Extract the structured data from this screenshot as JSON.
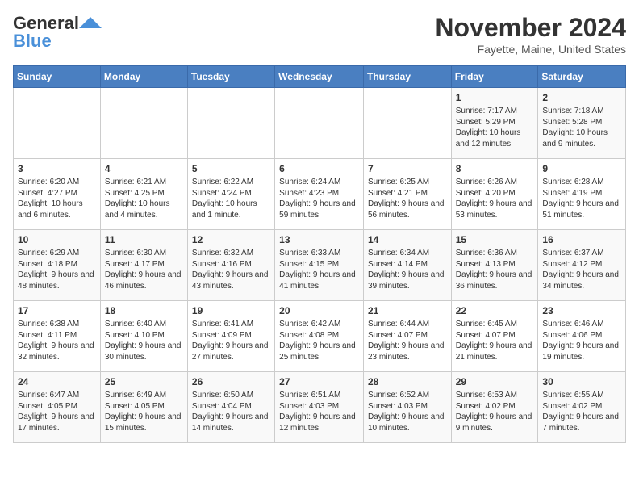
{
  "header": {
    "logo_general": "General",
    "logo_blue": "Blue",
    "month": "November 2024",
    "location": "Fayette, Maine, United States"
  },
  "weekdays": [
    "Sunday",
    "Monday",
    "Tuesday",
    "Wednesday",
    "Thursday",
    "Friday",
    "Saturday"
  ],
  "weeks": [
    [
      {
        "day": "",
        "info": ""
      },
      {
        "day": "",
        "info": ""
      },
      {
        "day": "",
        "info": ""
      },
      {
        "day": "",
        "info": ""
      },
      {
        "day": "",
        "info": ""
      },
      {
        "day": "1",
        "info": "Sunrise: 7:17 AM\nSunset: 5:29 PM\nDaylight: 10 hours and 12 minutes."
      },
      {
        "day": "2",
        "info": "Sunrise: 7:18 AM\nSunset: 5:28 PM\nDaylight: 10 hours and 9 minutes."
      }
    ],
    [
      {
        "day": "3",
        "info": "Sunrise: 6:20 AM\nSunset: 4:27 PM\nDaylight: 10 hours and 6 minutes."
      },
      {
        "day": "4",
        "info": "Sunrise: 6:21 AM\nSunset: 4:25 PM\nDaylight: 10 hours and 4 minutes."
      },
      {
        "day": "5",
        "info": "Sunrise: 6:22 AM\nSunset: 4:24 PM\nDaylight: 10 hours and 1 minute."
      },
      {
        "day": "6",
        "info": "Sunrise: 6:24 AM\nSunset: 4:23 PM\nDaylight: 9 hours and 59 minutes."
      },
      {
        "day": "7",
        "info": "Sunrise: 6:25 AM\nSunset: 4:21 PM\nDaylight: 9 hours and 56 minutes."
      },
      {
        "day": "8",
        "info": "Sunrise: 6:26 AM\nSunset: 4:20 PM\nDaylight: 9 hours and 53 minutes."
      },
      {
        "day": "9",
        "info": "Sunrise: 6:28 AM\nSunset: 4:19 PM\nDaylight: 9 hours and 51 minutes."
      }
    ],
    [
      {
        "day": "10",
        "info": "Sunrise: 6:29 AM\nSunset: 4:18 PM\nDaylight: 9 hours and 48 minutes."
      },
      {
        "day": "11",
        "info": "Sunrise: 6:30 AM\nSunset: 4:17 PM\nDaylight: 9 hours and 46 minutes."
      },
      {
        "day": "12",
        "info": "Sunrise: 6:32 AM\nSunset: 4:16 PM\nDaylight: 9 hours and 43 minutes."
      },
      {
        "day": "13",
        "info": "Sunrise: 6:33 AM\nSunset: 4:15 PM\nDaylight: 9 hours and 41 minutes."
      },
      {
        "day": "14",
        "info": "Sunrise: 6:34 AM\nSunset: 4:14 PM\nDaylight: 9 hours and 39 minutes."
      },
      {
        "day": "15",
        "info": "Sunrise: 6:36 AM\nSunset: 4:13 PM\nDaylight: 9 hours and 36 minutes."
      },
      {
        "day": "16",
        "info": "Sunrise: 6:37 AM\nSunset: 4:12 PM\nDaylight: 9 hours and 34 minutes."
      }
    ],
    [
      {
        "day": "17",
        "info": "Sunrise: 6:38 AM\nSunset: 4:11 PM\nDaylight: 9 hours and 32 minutes."
      },
      {
        "day": "18",
        "info": "Sunrise: 6:40 AM\nSunset: 4:10 PM\nDaylight: 9 hours and 30 minutes."
      },
      {
        "day": "19",
        "info": "Sunrise: 6:41 AM\nSunset: 4:09 PM\nDaylight: 9 hours and 27 minutes."
      },
      {
        "day": "20",
        "info": "Sunrise: 6:42 AM\nSunset: 4:08 PM\nDaylight: 9 hours and 25 minutes."
      },
      {
        "day": "21",
        "info": "Sunrise: 6:44 AM\nSunset: 4:07 PM\nDaylight: 9 hours and 23 minutes."
      },
      {
        "day": "22",
        "info": "Sunrise: 6:45 AM\nSunset: 4:07 PM\nDaylight: 9 hours and 21 minutes."
      },
      {
        "day": "23",
        "info": "Sunrise: 6:46 AM\nSunset: 4:06 PM\nDaylight: 9 hours and 19 minutes."
      }
    ],
    [
      {
        "day": "24",
        "info": "Sunrise: 6:47 AM\nSunset: 4:05 PM\nDaylight: 9 hours and 17 minutes."
      },
      {
        "day": "25",
        "info": "Sunrise: 6:49 AM\nSunset: 4:05 PM\nDaylight: 9 hours and 15 minutes."
      },
      {
        "day": "26",
        "info": "Sunrise: 6:50 AM\nSunset: 4:04 PM\nDaylight: 9 hours and 14 minutes."
      },
      {
        "day": "27",
        "info": "Sunrise: 6:51 AM\nSunset: 4:03 PM\nDaylight: 9 hours and 12 minutes."
      },
      {
        "day": "28",
        "info": "Sunrise: 6:52 AM\nSunset: 4:03 PM\nDaylight: 9 hours and 10 minutes."
      },
      {
        "day": "29",
        "info": "Sunrise: 6:53 AM\nSunset: 4:02 PM\nDaylight: 9 hours and 9 minutes."
      },
      {
        "day": "30",
        "info": "Sunrise: 6:55 AM\nSunset: 4:02 PM\nDaylight: 9 hours and 7 minutes."
      }
    ]
  ]
}
